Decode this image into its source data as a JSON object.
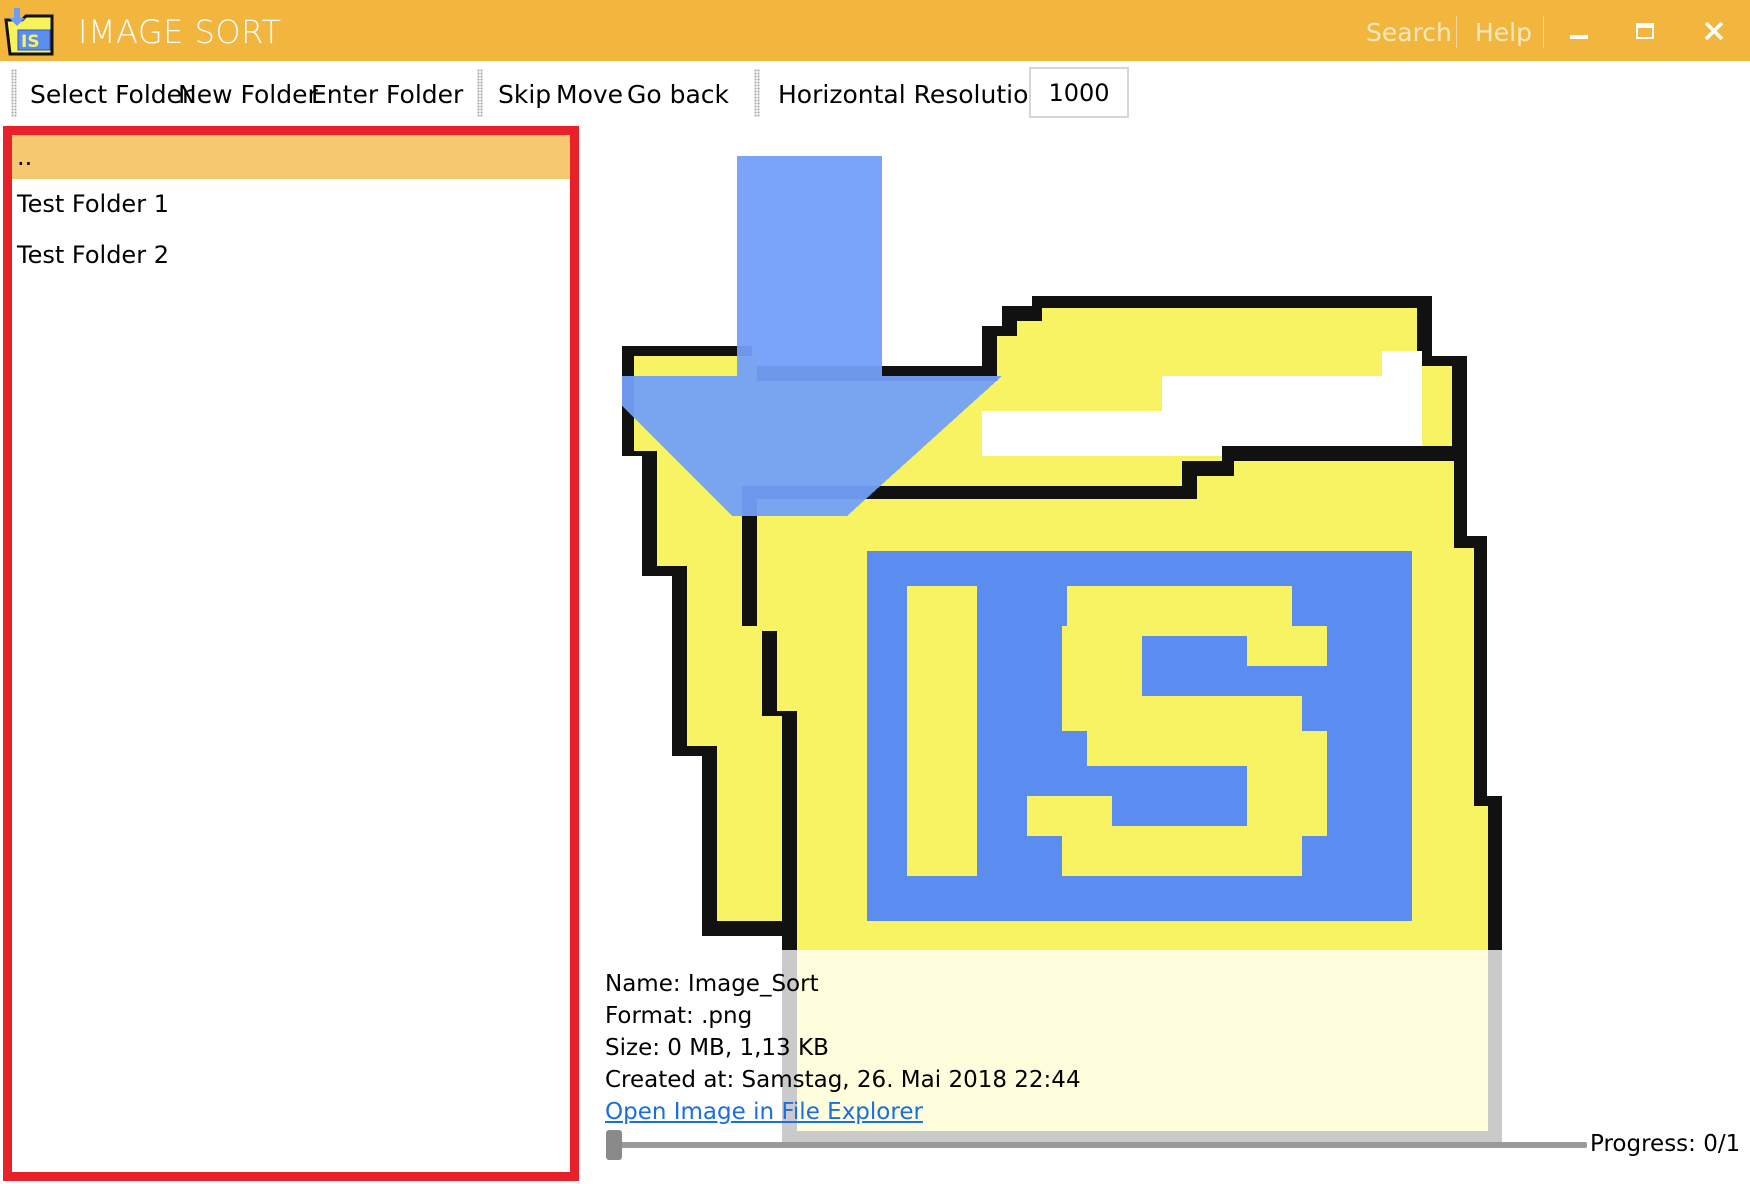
{
  "window": {
    "title": "IMAGE SORT",
    "search_label": "Search",
    "help_label": "Help",
    "accent_color": "#f2b63f",
    "icons": [
      "app-logo-icon",
      "minimize-icon",
      "maximize-icon",
      "close-icon"
    ]
  },
  "toolbar": {
    "select_folder": "Select Folder",
    "new_folder": "New Folder",
    "enter_folder": "Enter Folder",
    "skip": "Skip",
    "move": "Move",
    "go_back": "Go back",
    "resolution_label": "Horizontal Resolution:",
    "resolution_value": "1000"
  },
  "folders": {
    "items": [
      {
        "label": "..",
        "selected": true
      },
      {
        "label": "Test Folder 1",
        "selected": false
      },
      {
        "label": "Test Folder 2",
        "selected": false
      }
    ]
  },
  "image_info": {
    "name": "Name: Image_Sort",
    "format": "Format: .png",
    "size": "Size: 0 MB, 1,13 KB",
    "created": "Created at: Samstag, 26. Mai 2018 22:44",
    "open_link": "Open Image in File Explorer"
  },
  "progress": {
    "label": "Progress: 0/1",
    "current": 0,
    "total": 1
  }
}
